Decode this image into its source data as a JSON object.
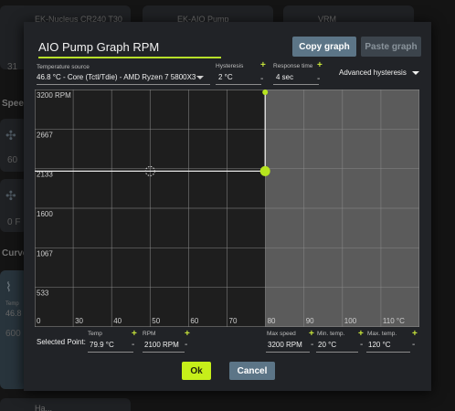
{
  "background": {
    "cards": [
      {
        "title": "EK-Nucleus CR240 T30"
      },
      {
        "title": "EK-AIO Pump"
      },
      {
        "title": "VRM"
      }
    ],
    "stat_value": "31",
    "speed_section": "Spee",
    "fan_values": [
      "60",
      "0 F"
    ],
    "curves_section": "Curve",
    "temp_label": "Temp",
    "temp_value": "46.8",
    "curve_value": "600",
    "bottom_card_title": "Ha..."
  },
  "dialog": {
    "title": "AIO Pump Graph RPM",
    "copy_label": "Copy graph",
    "paste_label": "Paste graph",
    "temperature_source": {
      "label": "Temperature source",
      "value": "46.8 °C - Core (Tctl/Tdie) - AMD Ryzen 7 5800X3"
    },
    "hysteresis": {
      "label": "Hysteresis",
      "value": "2 °C"
    },
    "response_time": {
      "label": "Response time",
      "value": "4 sec"
    },
    "advanced_hysteresis": "Advanced hysteresis",
    "selected_point": {
      "label": "Selected Point:",
      "temp_label": "Temp",
      "temp_value": "79.9 °C",
      "rpm_label": "RPM",
      "rpm_value": "2100 RPM",
      "max_speed_label": "Max speed",
      "max_speed_value": "3200 RPM",
      "min_temp_label": "Min. temp.",
      "min_temp_value": "20 °C",
      "max_temp_label": "Max. temp.",
      "max_temp_value": "120 °C"
    },
    "ok_label": "Ok",
    "cancel_label": "Cancel",
    "plus_symbol": "+",
    "minus_symbol": "-"
  },
  "chart_data": {
    "type": "line",
    "x_tick_labels": [
      "0",
      "30",
      "40",
      "50",
      "60",
      "70",
      "80",
      "90",
      "100",
      "110 °C"
    ],
    "y_tick_labels": [
      "3200 RPM",
      "2667",
      "2133",
      "1600",
      "1067",
      "533"
    ],
    "xlim": [
      20,
      120
    ],
    "ylim": [
      0,
      3200
    ],
    "series": [
      {
        "points": [
          [
            20,
            2100
          ],
          [
            79.9,
            2100
          ],
          [
            79.9,
            3200
          ]
        ]
      }
    ],
    "selected_point": [
      79.9,
      2100
    ],
    "ghost_point": [
      50,
      2100
    ],
    "colors": {
      "line": "#e8e8e8",
      "point": "#b6e51e",
      "grid": "#8a8a8a",
      "fill_left": "#1e1e1e",
      "fill_right": "#5b5b5b"
    }
  }
}
